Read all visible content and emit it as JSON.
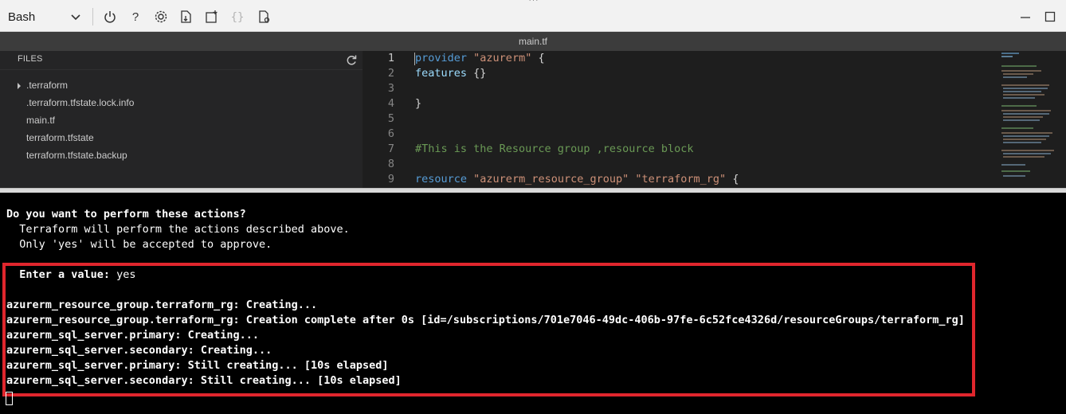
{
  "toolbar": {
    "shell": "Bash",
    "icons": [
      "power-icon",
      "help-icon",
      "settings-icon",
      "upload-download-icon",
      "new-session-icon",
      "braces-icon",
      "web-preview-icon"
    ]
  },
  "editor": {
    "title": "main.tf",
    "files_header": "FILES",
    "files": [
      {
        "name": ".terraform",
        "folder": true
      },
      {
        "name": ".terraform.tfstate.lock.info",
        "folder": false
      },
      {
        "name": "main.tf",
        "folder": false
      },
      {
        "name": "terraform.tfstate",
        "folder": false
      },
      {
        "name": "terraform.tfstate.backup",
        "folder": false
      }
    ],
    "line_numbers": [
      "1",
      "2",
      "3",
      "4",
      "5",
      "6",
      "7",
      "8",
      "9"
    ],
    "code": {
      "l1_kw": "provider",
      "l1_str": "\"azurerm\"",
      "l1_rest": " {",
      "l2_ident": "features",
      "l2_rest": " {}",
      "l4": "}",
      "l7_cmt": "#This is the Resource group ,resource block",
      "l9_kw": "resource",
      "l9_str1": "\"azurerm_resource_group\"",
      "l9_str2": "\"terraform_rg\"",
      "l9_rest": " {"
    }
  },
  "terminal": {
    "prompt_title": "Do you want to perform these actions?",
    "prompt_line1": "  Terraform will perform the actions described above.",
    "prompt_line2": "  Only 'yes' will be accepted to approve.",
    "enter_label": "  Enter a value:",
    "enter_value": " yes",
    "output": [
      "azurerm_resource_group.terraform_rg: Creating...",
      "azurerm_resource_group.terraform_rg: Creation complete after 0s [id=/subscriptions/701e7046-49dc-406b-97fe-6c52fce4326d/resourceGroups/terraform_rg]",
      "azurerm_sql_server.primary: Creating...",
      "azurerm_sql_server.secondary: Creating...",
      "azurerm_sql_server.primary: Still creating... [10s elapsed]",
      "azurerm_sql_server.secondary: Still creating... [10s elapsed]"
    ],
    "highlight_color": "#e0262d"
  }
}
